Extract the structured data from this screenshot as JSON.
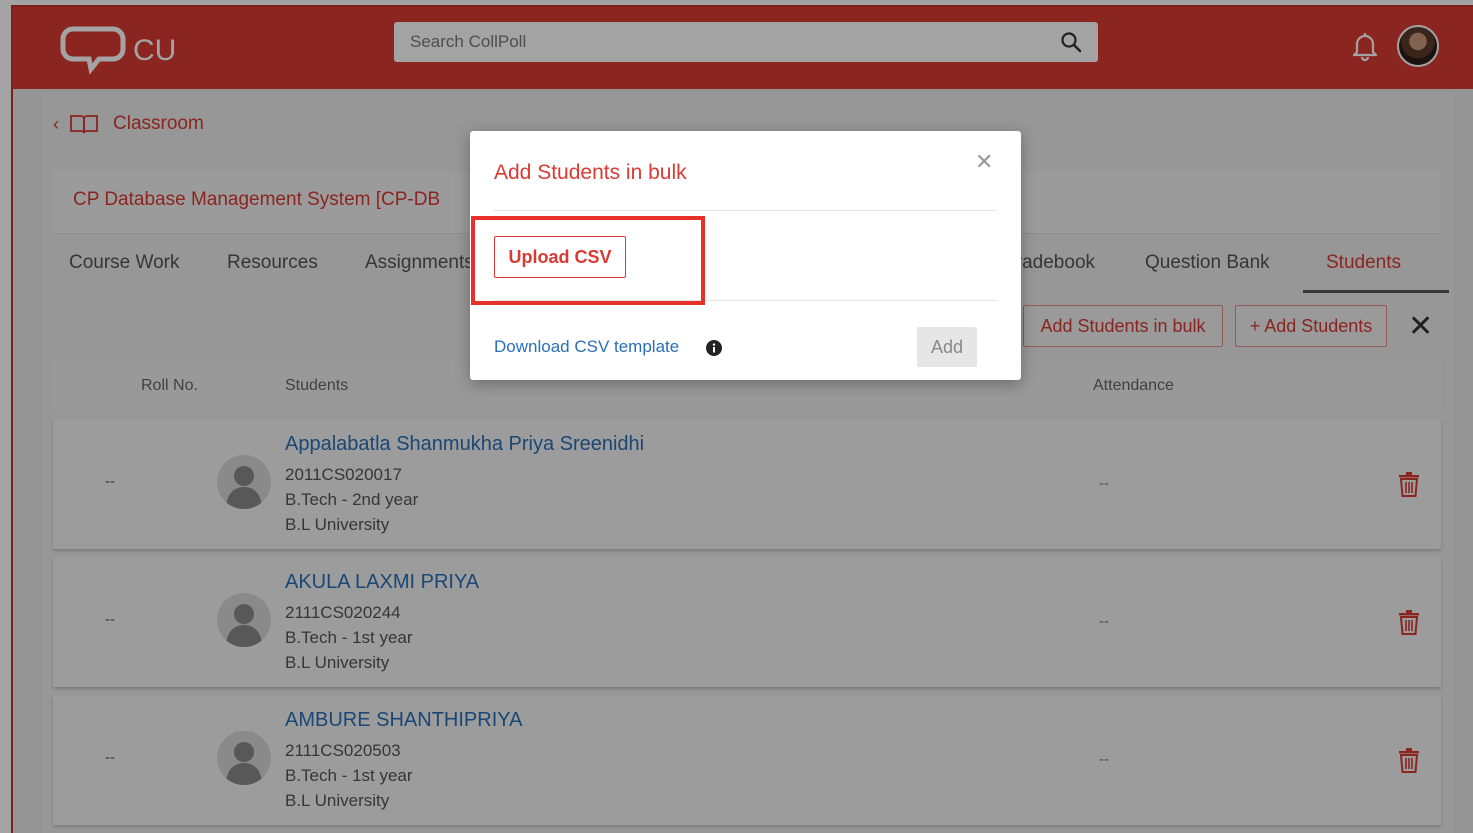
{
  "header": {
    "logo_text": "CU",
    "search_placeholder": "Search CollPoll"
  },
  "breadcrumb": {
    "label": "Classroom"
  },
  "course": {
    "title": "CP Database Management System [CP-DB"
  },
  "tabs": [
    {
      "label": "Course Work"
    },
    {
      "label": "Resources"
    },
    {
      "label": "Assignments"
    },
    {
      "label": "Gradebook"
    },
    {
      "label": "Question Bank"
    },
    {
      "label": "Students"
    }
  ],
  "active_tab": "Students",
  "actions": {
    "add_bulk_label": "Add Students in bulk",
    "add_students_label": "+ Add Students"
  },
  "table": {
    "headers": [
      "Roll No.",
      "Students",
      "Attendance"
    ],
    "rows": [
      {
        "roll": "--",
        "name": "Appalabatla Shanmukha Priya Sreenidhi",
        "id": "2011CS020017",
        "program": "B.Tech - 2nd year",
        "university": "B.L University",
        "attendance": "--"
      },
      {
        "roll": "--",
        "name": "AKULA LAXMI PRIYA",
        "id": "2111CS020244",
        "program": "B.Tech - 1st year",
        "university": "B.L University",
        "attendance": "--"
      },
      {
        "roll": "--",
        "name": "AMBURE SHANTHIPRIYA",
        "id": "2111CS020503",
        "program": "B.Tech - 1st year",
        "university": "B.L University",
        "attendance": "--"
      }
    ]
  },
  "modal": {
    "title": "Add Students in bulk",
    "upload_label": "Upload CSV",
    "download_label": "Download CSV template",
    "add_label": "Add"
  },
  "colors": {
    "brand": "#d93a33",
    "link": "#2a6fb8",
    "highlight": "#e8302a"
  }
}
